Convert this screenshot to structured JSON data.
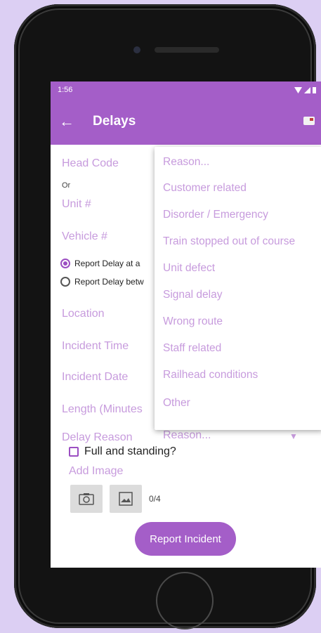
{
  "status_bar": {
    "time": "1:56"
  },
  "app_bar": {
    "back_glyph": "←",
    "title": "Delays",
    "mail_icon": "mail-icon"
  },
  "form": {
    "head_code_label": "Head Code",
    "or_text": "Or",
    "unit_label": "Unit #",
    "vehicle_label": "Vehicle #",
    "radio_at_label": "Report Delay at a",
    "radio_between_label": "Report Delay betw",
    "location_label": "Location",
    "incident_time_label": "Incident Time",
    "incident_date_label": "Incident Date",
    "length_label": "Length (Minutes",
    "delay_reason_label": "Delay Reason",
    "delay_reason_value": "Reason...",
    "full_standing_label": "Full and standing?",
    "add_image_label": "Add Image",
    "image_count": "0/4",
    "report_button": "Report Incident"
  },
  "dropdown": {
    "options": [
      "Reason...",
      "Customer related",
      "Disorder / Emergency",
      "Train stopped out of course",
      "Unit defect",
      "Signal delay",
      "Wrong route",
      "Staff related",
      "Railhead conditions",
      "Other"
    ]
  },
  "colors": {
    "accent": "#a45ec8",
    "label": "#c79bdd",
    "background": "#dccff3"
  }
}
